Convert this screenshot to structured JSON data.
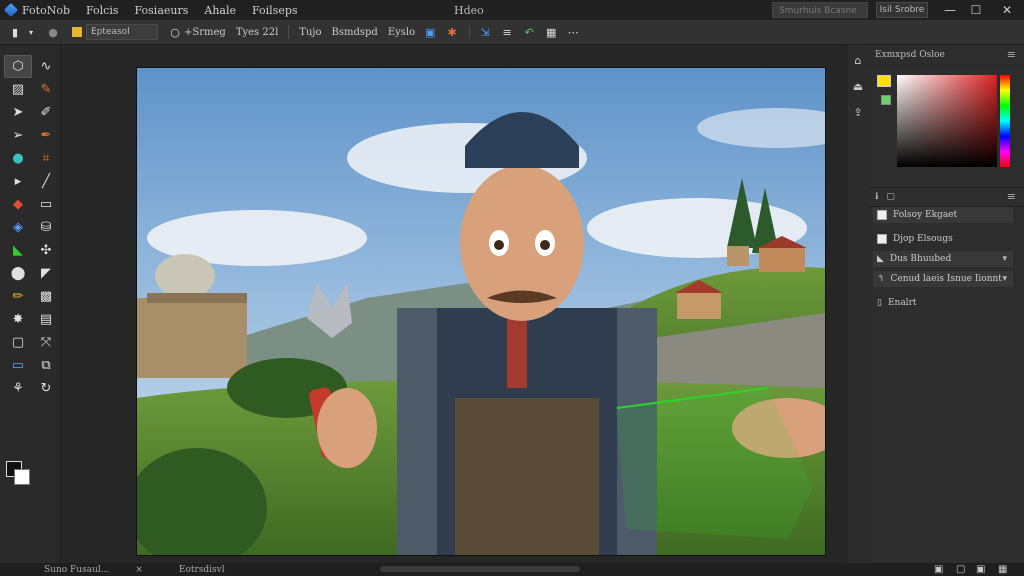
{
  "menubar": {
    "menus": [
      "FotoNob",
      "Folcis",
      "Fosiaeurs",
      "Ahale",
      "Foilseps"
    ],
    "doc_title": "Hdeo",
    "search_placeholder": "Smurhuis Bcasne",
    "share_label": "Isil Srobre",
    "window_controls": [
      "—",
      "☐",
      "✕"
    ]
  },
  "options_bar": {
    "layer_dropdown": "Epteasol",
    "mode_label": "+Srmeg",
    "type_label": "Tyes 22l",
    "tool_labels": [
      "Tujo",
      "Bsmdspd",
      "Eyslo"
    ]
  },
  "toolbar": {
    "tools": [
      "marquee-icon",
      "path-icon",
      "grid-icon",
      "pen-icon",
      "select-icon",
      "brush-icon",
      "arrow-icon",
      "eyedropper-icon",
      "sphere-icon",
      "crop-icon",
      "pointer-icon",
      "line-icon",
      "paint-icon",
      "eraser-icon",
      "gradient-icon",
      "stamp-icon",
      "shape-icon",
      "pin-icon",
      "circle-icon",
      "knife-icon",
      "pencil-icon",
      "mask-icon",
      "star-icon",
      "layers-icon",
      "rect-icon",
      "move-icon",
      "screen-icon",
      "copy-icon",
      "node-icon",
      "refresh-icon"
    ]
  },
  "right_dock": {
    "icons": [
      "home-icon",
      "share-icon",
      "export-icon"
    ]
  },
  "panels": {
    "color_panel_title": "Exmxpsd Osloe",
    "layers_tabs": [
      "ℹ",
      "▢"
    ],
    "layers": [
      {
        "label": "Folsoy Ekgaet",
        "arrow": ""
      },
      {
        "label": "Djop Elsougs",
        "arrow": ""
      },
      {
        "label": "Dus Bhuubed",
        "arrow": "▾"
      },
      {
        "label": "Cenud laeis Isnue Iionnt",
        "arrow": "▾"
      },
      {
        "label": "Enalrt",
        "arrow": ""
      }
    ]
  },
  "statusbar": {
    "left_text": "Suno Fusaul...",
    "mid_text": "Eotrsdisvl",
    "close_mark": "×"
  },
  "colors": {
    "accent": "#e8b62a",
    "selection": "#2bd62b"
  }
}
